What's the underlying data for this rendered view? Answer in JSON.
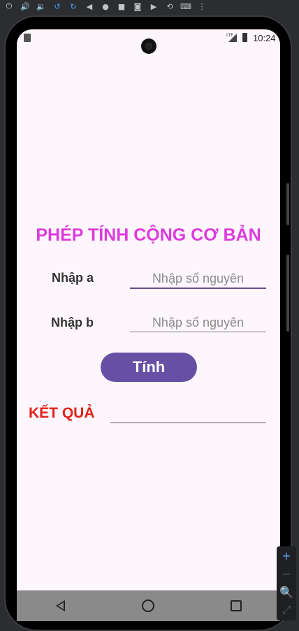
{
  "app": {
    "title": "PHÉP TÍNH CỘNG CƠ BẢN",
    "label_a": "Nhập a",
    "label_b": "Nhập b",
    "placeholder_a": "Nhập số nguyên",
    "placeholder_b": "Nhập số nguyên",
    "button_label": "Tính",
    "result_label": "KẾT QUẢ",
    "result_value": ""
  },
  "status_bar": {
    "time": "10:24",
    "network": "LTE"
  },
  "emulator_toolbar": {
    "icons": [
      "power-icon",
      "volume-up-icon",
      "volume-down-icon",
      "rotate-left-icon",
      "rotate-right-icon",
      "back-icon",
      "home-icon",
      "overview-icon",
      "camera-icon",
      "video-icon",
      "replay-icon",
      "keyboard-icon",
      "more-icon"
    ]
  },
  "zoom_panel": {
    "items": [
      "+",
      "−",
      "🔍",
      "⤢"
    ]
  },
  "colors": {
    "title": "#dd3bdc",
    "result_label": "#e2221a",
    "button": "#6750a4",
    "background": "#fdf7fd"
  }
}
